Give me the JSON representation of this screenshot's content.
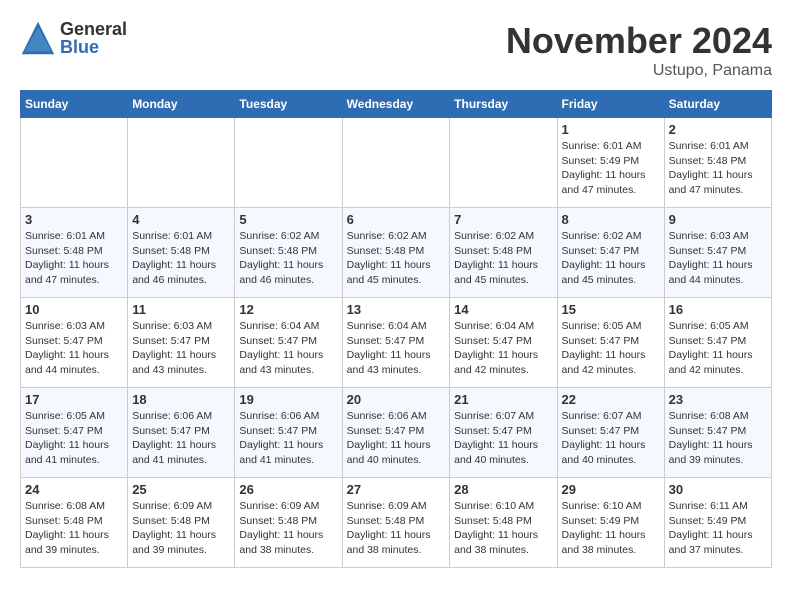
{
  "header": {
    "logo_general": "General",
    "logo_blue": "Blue",
    "month_title": "November 2024",
    "location": "Ustupo, Panama"
  },
  "days_of_week": [
    "Sunday",
    "Monday",
    "Tuesday",
    "Wednesday",
    "Thursday",
    "Friday",
    "Saturday"
  ],
  "weeks": [
    [
      {
        "day": "",
        "info": ""
      },
      {
        "day": "",
        "info": ""
      },
      {
        "day": "",
        "info": ""
      },
      {
        "day": "",
        "info": ""
      },
      {
        "day": "",
        "info": ""
      },
      {
        "day": "1",
        "info": "Sunrise: 6:01 AM\nSunset: 5:49 PM\nDaylight: 11 hours and 47 minutes."
      },
      {
        "day": "2",
        "info": "Sunrise: 6:01 AM\nSunset: 5:48 PM\nDaylight: 11 hours and 47 minutes."
      }
    ],
    [
      {
        "day": "3",
        "info": "Sunrise: 6:01 AM\nSunset: 5:48 PM\nDaylight: 11 hours and 47 minutes."
      },
      {
        "day": "4",
        "info": "Sunrise: 6:01 AM\nSunset: 5:48 PM\nDaylight: 11 hours and 46 minutes."
      },
      {
        "day": "5",
        "info": "Sunrise: 6:02 AM\nSunset: 5:48 PM\nDaylight: 11 hours and 46 minutes."
      },
      {
        "day": "6",
        "info": "Sunrise: 6:02 AM\nSunset: 5:48 PM\nDaylight: 11 hours and 45 minutes."
      },
      {
        "day": "7",
        "info": "Sunrise: 6:02 AM\nSunset: 5:48 PM\nDaylight: 11 hours and 45 minutes."
      },
      {
        "day": "8",
        "info": "Sunrise: 6:02 AM\nSunset: 5:47 PM\nDaylight: 11 hours and 45 minutes."
      },
      {
        "day": "9",
        "info": "Sunrise: 6:03 AM\nSunset: 5:47 PM\nDaylight: 11 hours and 44 minutes."
      }
    ],
    [
      {
        "day": "10",
        "info": "Sunrise: 6:03 AM\nSunset: 5:47 PM\nDaylight: 11 hours and 44 minutes."
      },
      {
        "day": "11",
        "info": "Sunrise: 6:03 AM\nSunset: 5:47 PM\nDaylight: 11 hours and 43 minutes."
      },
      {
        "day": "12",
        "info": "Sunrise: 6:04 AM\nSunset: 5:47 PM\nDaylight: 11 hours and 43 minutes."
      },
      {
        "day": "13",
        "info": "Sunrise: 6:04 AM\nSunset: 5:47 PM\nDaylight: 11 hours and 43 minutes."
      },
      {
        "day": "14",
        "info": "Sunrise: 6:04 AM\nSunset: 5:47 PM\nDaylight: 11 hours and 42 minutes."
      },
      {
        "day": "15",
        "info": "Sunrise: 6:05 AM\nSunset: 5:47 PM\nDaylight: 11 hours and 42 minutes."
      },
      {
        "day": "16",
        "info": "Sunrise: 6:05 AM\nSunset: 5:47 PM\nDaylight: 11 hours and 42 minutes."
      }
    ],
    [
      {
        "day": "17",
        "info": "Sunrise: 6:05 AM\nSunset: 5:47 PM\nDaylight: 11 hours and 41 minutes."
      },
      {
        "day": "18",
        "info": "Sunrise: 6:06 AM\nSunset: 5:47 PM\nDaylight: 11 hours and 41 minutes."
      },
      {
        "day": "19",
        "info": "Sunrise: 6:06 AM\nSunset: 5:47 PM\nDaylight: 11 hours and 41 minutes."
      },
      {
        "day": "20",
        "info": "Sunrise: 6:06 AM\nSunset: 5:47 PM\nDaylight: 11 hours and 40 minutes."
      },
      {
        "day": "21",
        "info": "Sunrise: 6:07 AM\nSunset: 5:47 PM\nDaylight: 11 hours and 40 minutes."
      },
      {
        "day": "22",
        "info": "Sunrise: 6:07 AM\nSunset: 5:47 PM\nDaylight: 11 hours and 40 minutes."
      },
      {
        "day": "23",
        "info": "Sunrise: 6:08 AM\nSunset: 5:47 PM\nDaylight: 11 hours and 39 minutes."
      }
    ],
    [
      {
        "day": "24",
        "info": "Sunrise: 6:08 AM\nSunset: 5:48 PM\nDaylight: 11 hours and 39 minutes."
      },
      {
        "day": "25",
        "info": "Sunrise: 6:09 AM\nSunset: 5:48 PM\nDaylight: 11 hours and 39 minutes."
      },
      {
        "day": "26",
        "info": "Sunrise: 6:09 AM\nSunset: 5:48 PM\nDaylight: 11 hours and 38 minutes."
      },
      {
        "day": "27",
        "info": "Sunrise: 6:09 AM\nSunset: 5:48 PM\nDaylight: 11 hours and 38 minutes."
      },
      {
        "day": "28",
        "info": "Sunrise: 6:10 AM\nSunset: 5:48 PM\nDaylight: 11 hours and 38 minutes."
      },
      {
        "day": "29",
        "info": "Sunrise: 6:10 AM\nSunset: 5:49 PM\nDaylight: 11 hours and 38 minutes."
      },
      {
        "day": "30",
        "info": "Sunrise: 6:11 AM\nSunset: 5:49 PM\nDaylight: 11 hours and 37 minutes."
      }
    ]
  ]
}
